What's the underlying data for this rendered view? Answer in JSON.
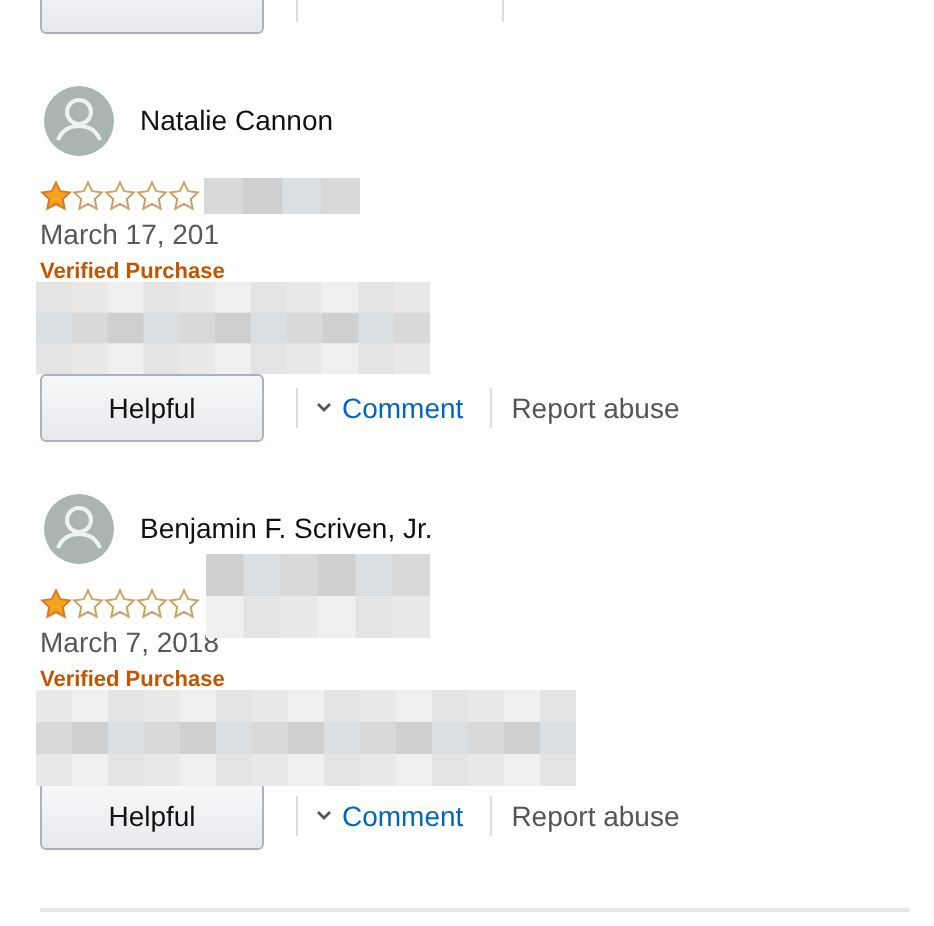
{
  "reviews": [
    {
      "name": "Natalie Cannon",
      "stars": 1,
      "date": "March 17, 201",
      "verified": "Verified Purchase",
      "redacted": true,
      "helpful": "Helpful",
      "comment": "Comment",
      "report": "Report abuse"
    },
    {
      "name": "Benjamin F. Scriven, Jr.",
      "stars": 1,
      "date": "March 7, 2018",
      "verified": "Verified Purchase",
      "redacted": true,
      "helpful": "Helpful",
      "comment": "Comment",
      "report": "Report abuse"
    }
  ]
}
